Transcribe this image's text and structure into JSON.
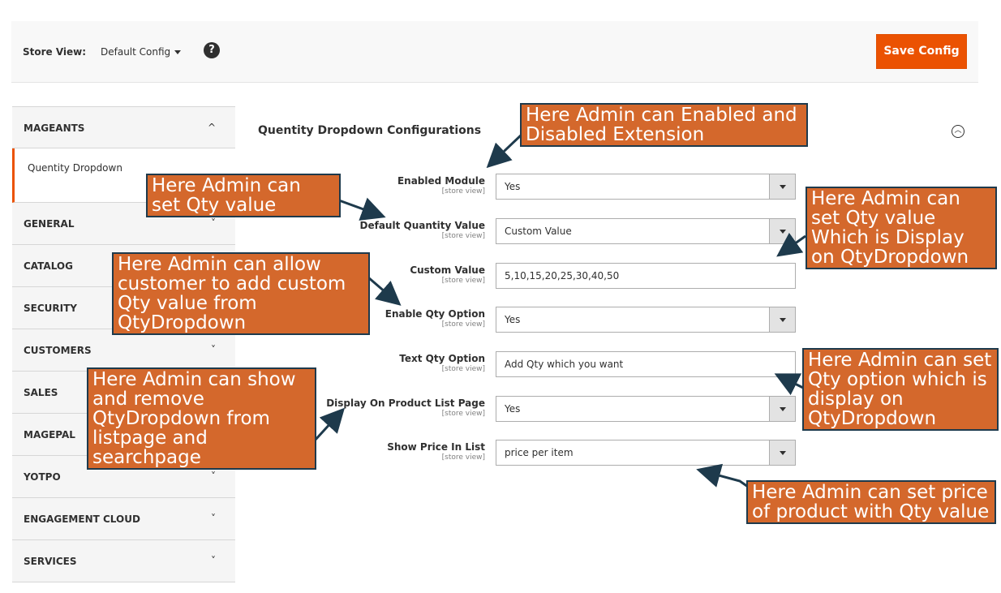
{
  "store_view": {
    "label": "Store View:",
    "value": "Default Config",
    "help_icon": "?"
  },
  "save_button": "Save Config",
  "sidebar": {
    "groups": [
      {
        "label": "MAGEANTS",
        "chevron": "^"
      },
      {
        "label": "GENERAL",
        "chevron": "˅"
      },
      {
        "label": "CATALOG",
        "chevron": "˅"
      },
      {
        "label": "SECURITY",
        "chevron": "˅"
      },
      {
        "label": "CUSTOMERS",
        "chevron": "˅"
      },
      {
        "label": "SALES",
        "chevron": "˅"
      },
      {
        "label": "MAGEPAL",
        "chevron": "˅"
      },
      {
        "label": "YOTPO",
        "chevron": "˅"
      },
      {
        "label": "ENGAGEMENT CLOUD",
        "chevron": "˅"
      },
      {
        "label": "SERVICES",
        "chevron": "˅"
      }
    ],
    "active_item": "Quentity Dropdown"
  },
  "section": {
    "title": "Quentity Dropdown Configurations"
  },
  "fields": [
    {
      "label": "Enabled Module",
      "scope": "[store view]",
      "value": "Yes",
      "type": "select"
    },
    {
      "label": "Default Quantity Value",
      "scope": "[store view]",
      "value": "Custom Value",
      "type": "select"
    },
    {
      "label": "Custom Value",
      "scope": "[store view]",
      "value": "5,10,15,20,25,30,40,50",
      "type": "text"
    },
    {
      "label": "Enable Qty Option",
      "scope": "[store view]",
      "value": "Yes",
      "type": "select"
    },
    {
      "label": "Text Qty Option",
      "scope": "[store view]",
      "value": "Add Qty which you want",
      "type": "text"
    },
    {
      "label": "Display On Product List Page",
      "scope": "[store view]",
      "value": "Yes",
      "type": "select"
    },
    {
      "label": "Show Price In List",
      "scope": "[store view]",
      "value": "price per item",
      "type": "select"
    }
  ],
  "callouts": [
    {
      "text": "Here Admin can Enabled and Disabled Extension"
    },
    {
      "text": "Here Admin can set Qty value"
    },
    {
      "text": "Here Admin can allow customer to add custom Qty value from QtyDropdown"
    },
    {
      "text": "Here Admin can show and remove QtyDropdown from listpage and searchpage"
    },
    {
      "text": "Here Admin can set Qty value Which is Display on QtyDropdown"
    },
    {
      "text": "Here Admin can set Qty option which is display on QtyDropdown"
    },
    {
      "text": "Here Admin can set price of product with Qty value"
    }
  ],
  "colors": {
    "accent": "#eb5202",
    "callout_bg": "#d4682c",
    "callout_border": "#1e3a4c"
  }
}
